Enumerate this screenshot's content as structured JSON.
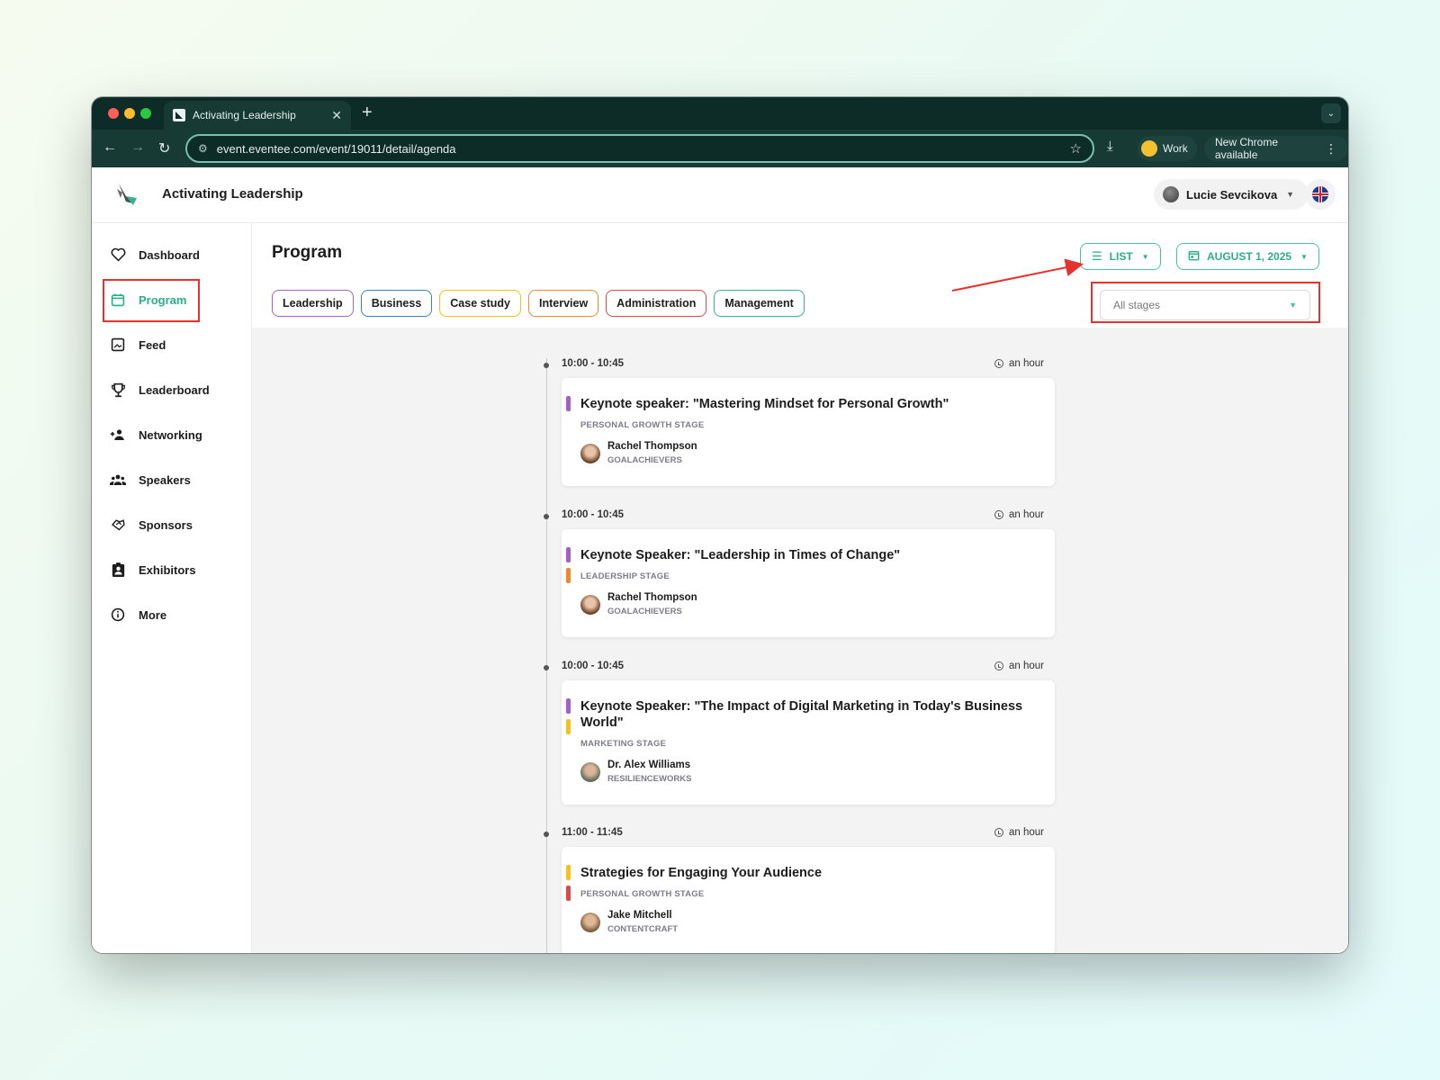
{
  "browser": {
    "tab_title": "Activating Leadership",
    "url": "event.eventee.com/event/19011/detail/agenda",
    "profile_label": "Work",
    "update_label": "New Chrome available"
  },
  "app": {
    "title": "Activating Leadership",
    "user_name": "Lucie Sevcikova",
    "accent_color": "#2aae86"
  },
  "sidebar": {
    "items": [
      {
        "label": "Dashboard",
        "icon": "heart-icon"
      },
      {
        "label": "Program",
        "icon": "calendar-icon",
        "active": true
      },
      {
        "label": "Feed",
        "icon": "image-icon"
      },
      {
        "label": "Leaderboard",
        "icon": "trophy-icon"
      },
      {
        "label": "Networking",
        "icon": "people-add-icon"
      },
      {
        "label": "Speakers",
        "icon": "group-icon"
      },
      {
        "label": "Sponsors",
        "icon": "handshake-icon"
      },
      {
        "label": "Exhibitors",
        "icon": "badge-icon"
      },
      {
        "label": "More",
        "icon": "info-icon"
      }
    ]
  },
  "main": {
    "title": "Program",
    "view_label": "LIST",
    "date_label": "AUGUST 1, 2025",
    "stage_filter": "All stages",
    "chips": [
      {
        "label": "Leadership",
        "color": "#a55fc9"
      },
      {
        "label": "Business",
        "color": "#3b7fc4"
      },
      {
        "label": "Case study",
        "color": "#f2c21b"
      },
      {
        "label": "Interview",
        "color": "#ef8a2b"
      },
      {
        "label": "Administration",
        "color": "#e04848"
      },
      {
        "label": "Management",
        "color": "#37b393"
      }
    ]
  },
  "sessions": [
    {
      "time": "10:00 - 10:45",
      "duration": "an hour",
      "title": "Keynote speaker: \"Mastering Mindset for Personal Growth\"",
      "stage": "PERSONAL GROWTH STAGE",
      "tag_colors": [
        "#a55fc9"
      ],
      "speaker": "Rachel Thompson",
      "company": "GOALACHIEVERS"
    },
    {
      "time": "10:00 - 10:45",
      "duration": "an hour",
      "title": "Keynote Speaker: \"Leadership in Times of Change\"",
      "stage": "LEADERSHIP STAGE",
      "tag_colors": [
        "#a55fc9",
        "#ef8a2b"
      ],
      "speaker": "Rachel Thompson",
      "company": "GOALACHIEVERS"
    },
    {
      "time": "10:00 - 10:45",
      "duration": "an hour",
      "title": "Keynote Speaker: \"The Impact of Digital Marketing in Today's Business World\"",
      "stage": "MARKETING STAGE",
      "tag_colors": [
        "#a55fc9",
        "#f2c21b"
      ],
      "speaker": "Dr. Alex Williams",
      "company": "RESILIENCEWORKS"
    },
    {
      "time": "11:00 - 11:45",
      "duration": "an hour",
      "title": "Strategies for Engaging Your Audience",
      "stage": "PERSONAL GROWTH STAGE",
      "tag_colors": [
        "#f2c21b",
        "#e04848"
      ],
      "speaker": "Jake Mitchell",
      "company": "CONTENTCRAFT"
    }
  ]
}
